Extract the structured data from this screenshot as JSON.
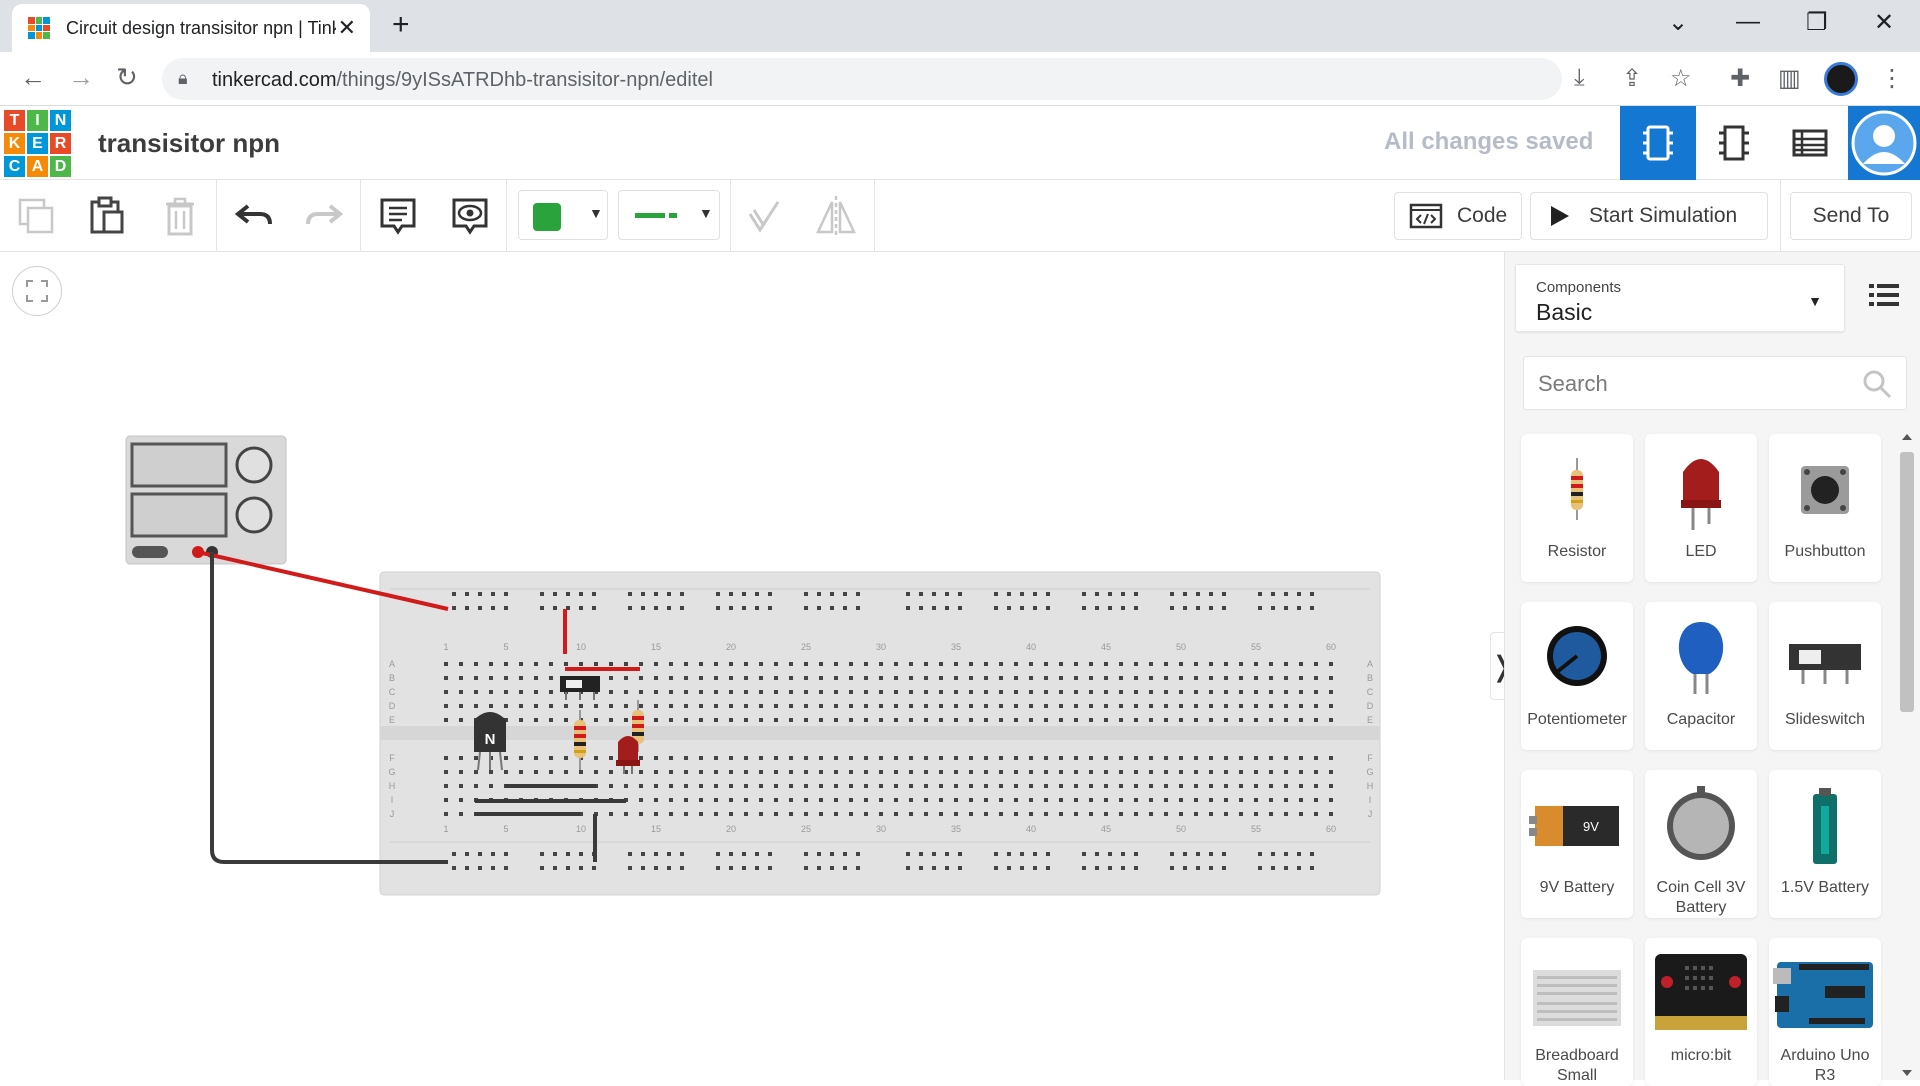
{
  "browser": {
    "tab_title": "Circuit design transisitor npn | Tinkercad",
    "url_host": "tinkercad.com",
    "url_path": "/things/9yISsATRDhb-transisitor-npn/editel"
  },
  "header": {
    "logo_letters": [
      "T",
      "I",
      "N",
      "K",
      "E",
      "R",
      "C",
      "A",
      "D"
    ],
    "logo_colors": [
      "#e84a27",
      "#4db849",
      "#0097d8",
      "#f58a07",
      "#0097d8",
      "#e84a27",
      "#0097d8",
      "#f58a07",
      "#4db849"
    ],
    "project_name": "transisitor npn",
    "save_status": "All changes saved",
    "active_view_color": "#1477d1"
  },
  "toolbar": {
    "color_swatch": "#2aa33c",
    "code_label": "Code",
    "start_label": "Start Simulation",
    "send_label": "Send To"
  },
  "panel": {
    "components_label": "Components",
    "components_value": "Basic",
    "search_placeholder": "Search",
    "items": [
      {
        "name": "Resistor",
        "icon": "resistor-icon"
      },
      {
        "name": "LED",
        "icon": "led-icon"
      },
      {
        "name": "Pushbutton",
        "icon": "pushbutton-icon"
      },
      {
        "name": "Potentiometer",
        "icon": "potentiometer-icon"
      },
      {
        "name": "Capacitor",
        "icon": "capacitor-icon"
      },
      {
        "name": "Slideswitch",
        "icon": "slideswitch-icon"
      },
      {
        "name": "9V Battery",
        "icon": "battery-9v-icon"
      },
      {
        "name": "Coin Cell 3V Battery",
        "icon": "coin-cell-icon"
      },
      {
        "name": "1.5V Battery",
        "icon": "battery-15v-icon"
      },
      {
        "name": "Breadboard Small",
        "icon": "breadboard-icon"
      },
      {
        "name": "micro:bit",
        "icon": "microbit-icon"
      },
      {
        "name": "Arduino Uno R3",
        "icon": "arduino-icon"
      }
    ]
  },
  "breadboard": {
    "column_numbers": [
      "1",
      "5",
      "10",
      "15",
      "20",
      "25",
      "30",
      "35",
      "40",
      "45",
      "50",
      "55",
      "60"
    ],
    "row_letters_top": [
      "A",
      "B",
      "C",
      "D",
      "E"
    ],
    "row_letters_bottom": [
      "F",
      "G",
      "H",
      "I",
      "J"
    ],
    "transistor_label": "N"
  }
}
